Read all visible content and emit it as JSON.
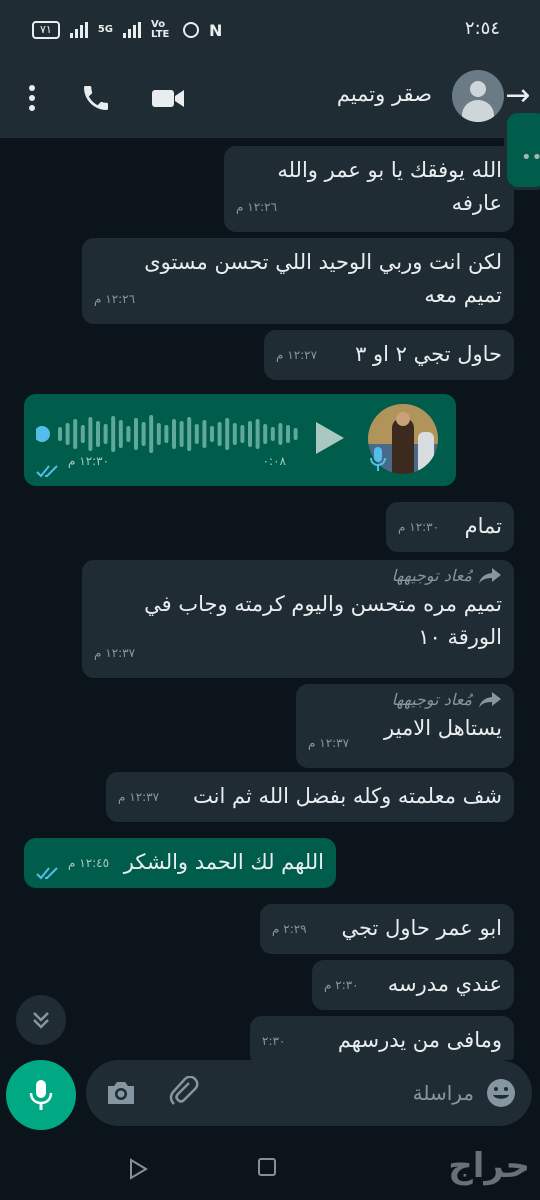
{
  "status_bar": {
    "time": "٢:٥٤",
    "battery": "٧١",
    "network": "5G",
    "volte": "Vo LTE"
  },
  "header": {
    "contact_name": "صقر وتميم",
    "icons": [
      "back-arrow-icon",
      "avatar",
      "video-call-icon",
      "voice-call-icon",
      "menu-icon"
    ]
  },
  "messages": [
    {
      "type": "in",
      "text": "الله يوفقك يا بو عمر والله عارفه",
      "time": "١٢:٢٦ م"
    },
    {
      "type": "in",
      "text": "لكن انت وربي الوحيد اللي تحسن مستوى تميم معه",
      "time": "١٢:٢٦ م"
    },
    {
      "type": "in",
      "text": "حاول تجي ٢ او ٣",
      "time": "١٢:٢٧ م"
    },
    {
      "type": "out-voice",
      "duration": "٠:٠٨",
      "time": "١٢:٣٠ م",
      "progress": 0
    },
    {
      "type": "in",
      "text": "تمام",
      "time": "١٢:٣٠ م"
    },
    {
      "type": "in",
      "forwarded": "مُعاد توجيهها",
      "text": "تميم مره متحسن واليوم كرمته وجاب في الورقة ١٠",
      "time": "١٢:٣٧ م"
    },
    {
      "type": "in",
      "forwarded": "مُعاد توجيهها",
      "text": "يستاهل الامير",
      "time": "١٢:٣٧ م"
    },
    {
      "type": "in",
      "text": "شف معلمته وكله بفضل الله ثم انت",
      "time": "١٢:٣٧ م"
    },
    {
      "type": "out",
      "text": "اللهم لك الحمد والشكر",
      "time": "١٢:٤٥ م"
    },
    {
      "type": "in",
      "text": "ابو عمر حاول تجي",
      "time": "٢:٢٩ م"
    },
    {
      "type": "in",
      "text": "عندي مدرسه",
      "time": "٢:٣٠ م"
    },
    {
      "type": "in",
      "text": "ومافى من يدرسهم",
      "time": "٢:٣٠"
    }
  ],
  "composer": {
    "placeholder": "مراسلة"
  },
  "navbar": {
    "watermark": "حراج"
  },
  "colors": {
    "background": "#0b141a",
    "bar": "#1f2c34",
    "incoming_bubble": "#202c33",
    "outgoing_bubble": "#005c4b",
    "accent": "#00a884",
    "read_ticks": "#53bdeb"
  }
}
